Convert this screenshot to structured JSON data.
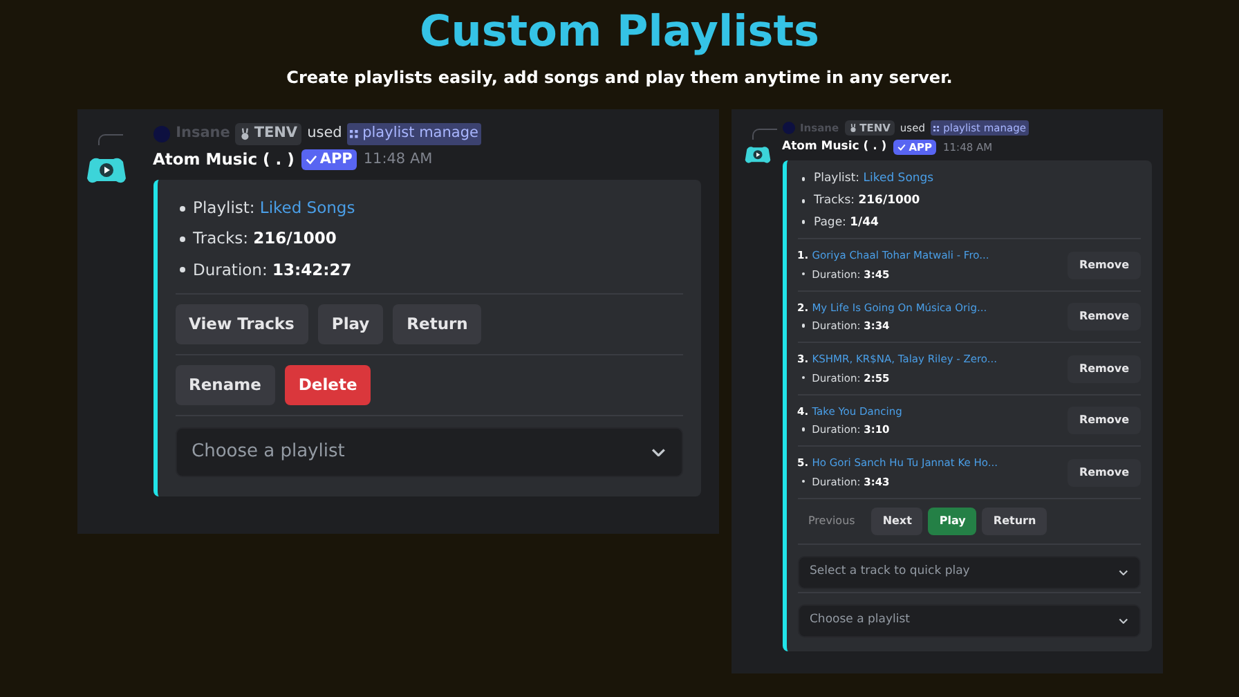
{
  "header": {
    "title": "Custom Playlists",
    "subtitle": "Create playlists easily, add songs and play them anytime in any server."
  },
  "panels": [
    {
      "reply": {
        "user": "Insane",
        "tag": "TENV",
        "used": "used",
        "command": "playlist manage"
      },
      "author": "Atom Music ( . )",
      "badge": "APP",
      "time": "11:48 AM",
      "fields": [
        {
          "label": "Playlist:",
          "value": "Liked Songs",
          "kind": "link"
        },
        {
          "label": "Tracks:",
          "value": "216/1000",
          "kind": "bold"
        },
        {
          "label": "Duration:",
          "value": "13:42:27",
          "kind": "bold"
        }
      ],
      "button_rows": [
        [
          {
            "label": "View Tracks",
            "kind": "secondary",
            "disabled": false
          },
          {
            "label": "Play",
            "kind": "secondary",
            "disabled": false
          },
          {
            "label": "Return",
            "kind": "secondary",
            "disabled": false
          }
        ],
        [
          {
            "label": "Rename",
            "kind": "secondary",
            "disabled": false
          },
          {
            "label": "Delete",
            "kind": "danger",
            "disabled": false
          }
        ]
      ],
      "selects": [
        {
          "placeholder": "Choose a playlist"
        }
      ]
    },
    {
      "reply": {
        "user": "Insane",
        "tag": "TENV",
        "used": "used",
        "command": "playlist manage"
      },
      "author": "Atom Music ( . )",
      "badge": "APP",
      "time": "11:48 AM",
      "fields": [
        {
          "label": "Playlist:",
          "value": "Liked Songs",
          "kind": "link"
        },
        {
          "label": "Tracks:",
          "value": "216/1000",
          "kind": "bold"
        },
        {
          "label": "Page:",
          "value": "1/44",
          "kind": "bold"
        }
      ],
      "tracks": [
        {
          "number": "1.",
          "title": "Goriya Chaal Tohar Matwali - Fro...",
          "duration_label": "Duration:",
          "duration": "3:45",
          "button": "Remove"
        },
        {
          "number": "2.",
          "title": "My Life Is Going On Música Orig...",
          "duration_label": "Duration:",
          "duration": "3:34",
          "button": "Remove"
        },
        {
          "number": "3.",
          "title": "KSHMR, KR$NA, Talay Riley - Zero...",
          "duration_label": "Duration:",
          "duration": "2:55",
          "button": "Remove"
        },
        {
          "number": "4.",
          "title": "Take You Dancing",
          "duration_label": "Duration:",
          "duration": "3:10",
          "button": "Remove"
        },
        {
          "number": "5.",
          "title": "Ho Gori Sanch Hu Tu Jannat Ke Ho...",
          "duration_label": "Duration:",
          "duration": "3:43",
          "button": "Remove"
        }
      ],
      "button_rows": [
        [
          {
            "label": "Previous",
            "kind": "secondary",
            "disabled": true
          },
          {
            "label": "Next",
            "kind": "secondary",
            "disabled": false
          },
          {
            "label": "Play",
            "kind": "success",
            "disabled": false
          },
          {
            "label": "Return",
            "kind": "secondary",
            "disabled": false
          }
        ]
      ],
      "selects": [
        {
          "placeholder": "Select a track to quick play"
        },
        {
          "placeholder": "Choose a playlist"
        }
      ]
    }
  ]
}
